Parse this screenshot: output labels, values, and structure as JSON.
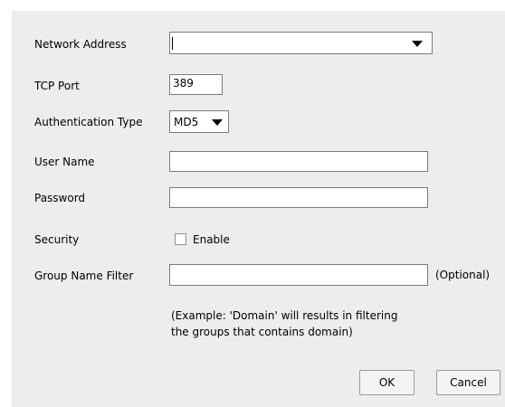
{
  "form": {
    "network_address": {
      "label": "Network Address",
      "value": ""
    },
    "tcp_port": {
      "label": "TCP Port",
      "value": "389"
    },
    "auth_type": {
      "label": "Authentication Type",
      "value": "MD5"
    },
    "user_name": {
      "label": "User Name",
      "value": ""
    },
    "password": {
      "label": "Password",
      "value": ""
    },
    "security": {
      "label": "Security",
      "checkbox_label": "Enable",
      "checked": false
    },
    "group_filter": {
      "label": "Group Name Filter",
      "value": "",
      "optional": "(Optional)",
      "example_line1": "(Example: 'Domain' will results in filtering",
      "example_line2": "the groups that contains domain)"
    }
  },
  "buttons": {
    "ok": "OK",
    "cancel": "Cancel"
  }
}
